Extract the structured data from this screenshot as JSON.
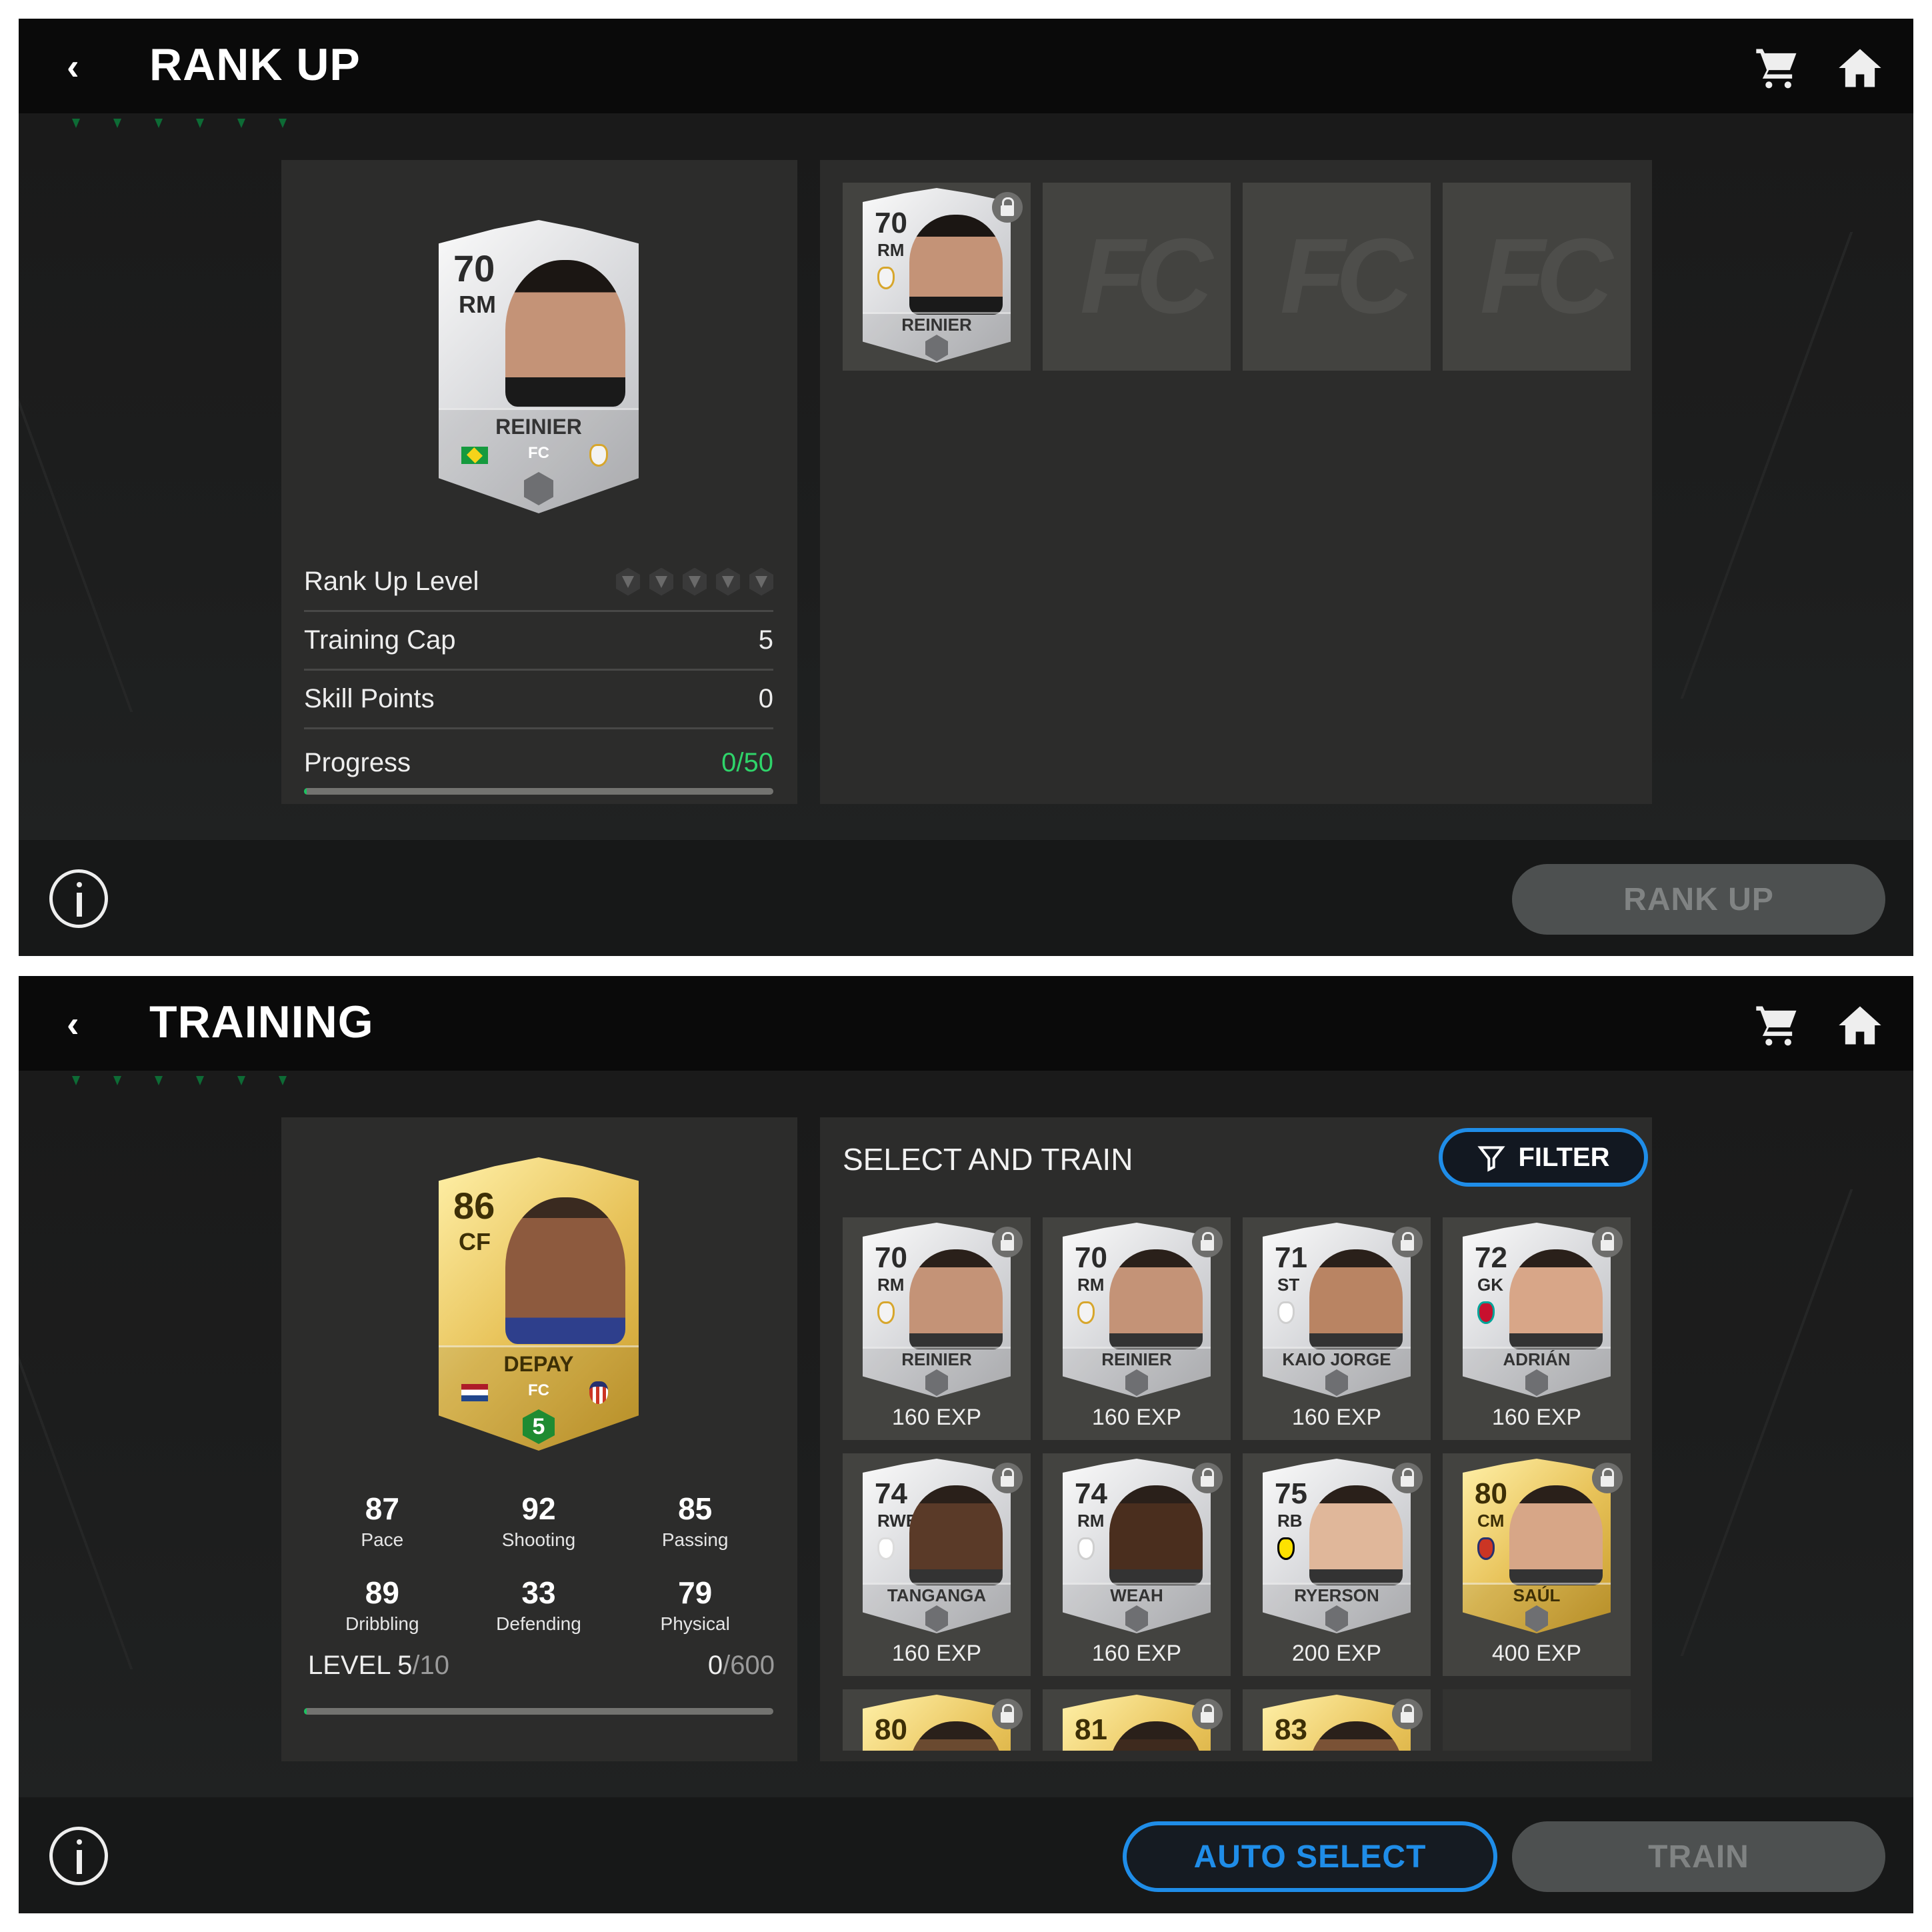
{
  "rank_up_screen": {
    "title": "RANK UP",
    "player_card": {
      "rating": "70",
      "position": "RM",
      "name": "REINIER",
      "tier": "silver",
      "nation": "Brazil",
      "club": "Real Madrid",
      "nation_colors": [
        "#159a3e",
        "#f6d31a",
        "#1c3e95"
      ],
      "club_colors": [
        "#f3f3f3",
        "#d7a62c"
      ]
    },
    "stats": [
      {
        "label": "Rank Up Level",
        "value": "",
        "type": "gems",
        "gems": 5
      },
      {
        "label": "Training Cap",
        "value": "5"
      },
      {
        "label": "Skill Points",
        "value": "0"
      }
    ],
    "progress": {
      "label": "Progress",
      "value": "0/50",
      "current": 0,
      "max": 50
    },
    "slots": [
      {
        "filled": true,
        "rating": "70",
        "position": "RM",
        "name": "REINIER",
        "tier": "silver",
        "club_colors": [
          "#f3f3f3",
          "#d7a62c"
        ],
        "locked": true
      },
      {
        "filled": false,
        "watermark": "FC"
      },
      {
        "filled": false,
        "watermark": "FC"
      },
      {
        "filled": false,
        "watermark": "FC"
      }
    ],
    "rank_up_button": "RANK UP"
  },
  "training_screen": {
    "title": "TRAINING",
    "player_card": {
      "rating": "86",
      "position": "CF",
      "name": "DEPAY",
      "tier": "gold",
      "nation": "Netherlands",
      "club": "Atletico Madrid",
      "nation_colors": [
        "#ae1c28",
        "#ffffff",
        "#21468b"
      ],
      "club_colors": [
        "#cb3524",
        "#27306e"
      ],
      "level_badge": "5"
    },
    "attributes": [
      {
        "value": "87",
        "label": "Pace"
      },
      {
        "value": "92",
        "label": "Shooting"
      },
      {
        "value": "85",
        "label": "Passing"
      },
      {
        "value": "89",
        "label": "Dribbling"
      },
      {
        "value": "33",
        "label": "Defending"
      },
      {
        "value": "79",
        "label": "Physical"
      }
    ],
    "level": {
      "prefix": "LEVEL",
      "current": "5",
      "max": "/10",
      "exp_current": "0",
      "exp_max": "/600",
      "progress": 0
    },
    "section_title": "SELECT AND TRAIN",
    "filter_label": "FILTER",
    "cards": [
      {
        "rating": "70",
        "position": "RM",
        "name": "REINIER",
        "exp": "160 EXP",
        "tier": "silver",
        "club_colors": [
          "#f3f3f3",
          "#d7a62c"
        ],
        "locked": true
      },
      {
        "rating": "70",
        "position": "RM",
        "name": "REINIER",
        "exp": "160 EXP",
        "tier": "silver",
        "club_colors": [
          "#f3f3f3",
          "#d7a62c"
        ],
        "locked": true
      },
      {
        "rating": "71",
        "position": "ST",
        "name": "KAIO JORGE",
        "exp": "160 EXP",
        "tier": "silver",
        "club_colors": [
          "#ffffff",
          "#cfcfcf"
        ],
        "locked": true
      },
      {
        "rating": "72",
        "position": "GK",
        "name": "ADRIÁN",
        "exp": "160 EXP",
        "tier": "silver",
        "club_colors": [
          "#c8102e",
          "#00a398"
        ],
        "locked": true
      },
      {
        "rating": "74",
        "position": "RWB",
        "name": "TANGANGA",
        "exp": "160 EXP",
        "tier": "silver",
        "club_colors": [
          "#ffffff",
          "#dcdcdc"
        ],
        "locked": true
      },
      {
        "rating": "74",
        "position": "RM",
        "name": "WEAH",
        "exp": "160 EXP",
        "tier": "silver",
        "club_colors": [
          "#ffffff",
          "#cfcfcf"
        ],
        "locked": true
      },
      {
        "rating": "75",
        "position": "RB",
        "name": "RYERSON",
        "exp": "200 EXP",
        "tier": "silver",
        "club_colors": [
          "#fde100",
          "#000000"
        ],
        "locked": true
      },
      {
        "rating": "80",
        "position": "CM",
        "name": "SAÚL",
        "exp": "400 EXP",
        "tier": "gold",
        "club_colors": [
          "#cb3524",
          "#27306e"
        ],
        "locked": true
      },
      {
        "rating": "80",
        "position": "",
        "name": "",
        "exp": "",
        "tier": "gold",
        "club_colors": [
          "#e0c050",
          "#e0c050"
        ],
        "locked": true
      },
      {
        "rating": "81",
        "position": "",
        "name": "",
        "exp": "",
        "tier": "gold",
        "club_colors": [
          "#e0c050",
          "#e0c050"
        ],
        "locked": true
      },
      {
        "rating": "83",
        "position": "",
        "name": "",
        "exp": "",
        "tier": "gold",
        "club_colors": [
          "#e0c050",
          "#e0c050"
        ],
        "locked": true
      }
    ],
    "auto_select_button": "AUTO SELECT",
    "train_button": "TRAIN"
  },
  "icons": {
    "back": "‹",
    "cart": "cart-icon",
    "home": "home-icon",
    "info": "info-icon",
    "filter": "filter-icon",
    "lock": "lock-icon"
  },
  "colors": {
    "accent_blue": "#1f8de8",
    "progress_green": "#2fd46a",
    "panel": "#2c2c2b",
    "disabled_button": "#4d5050"
  }
}
